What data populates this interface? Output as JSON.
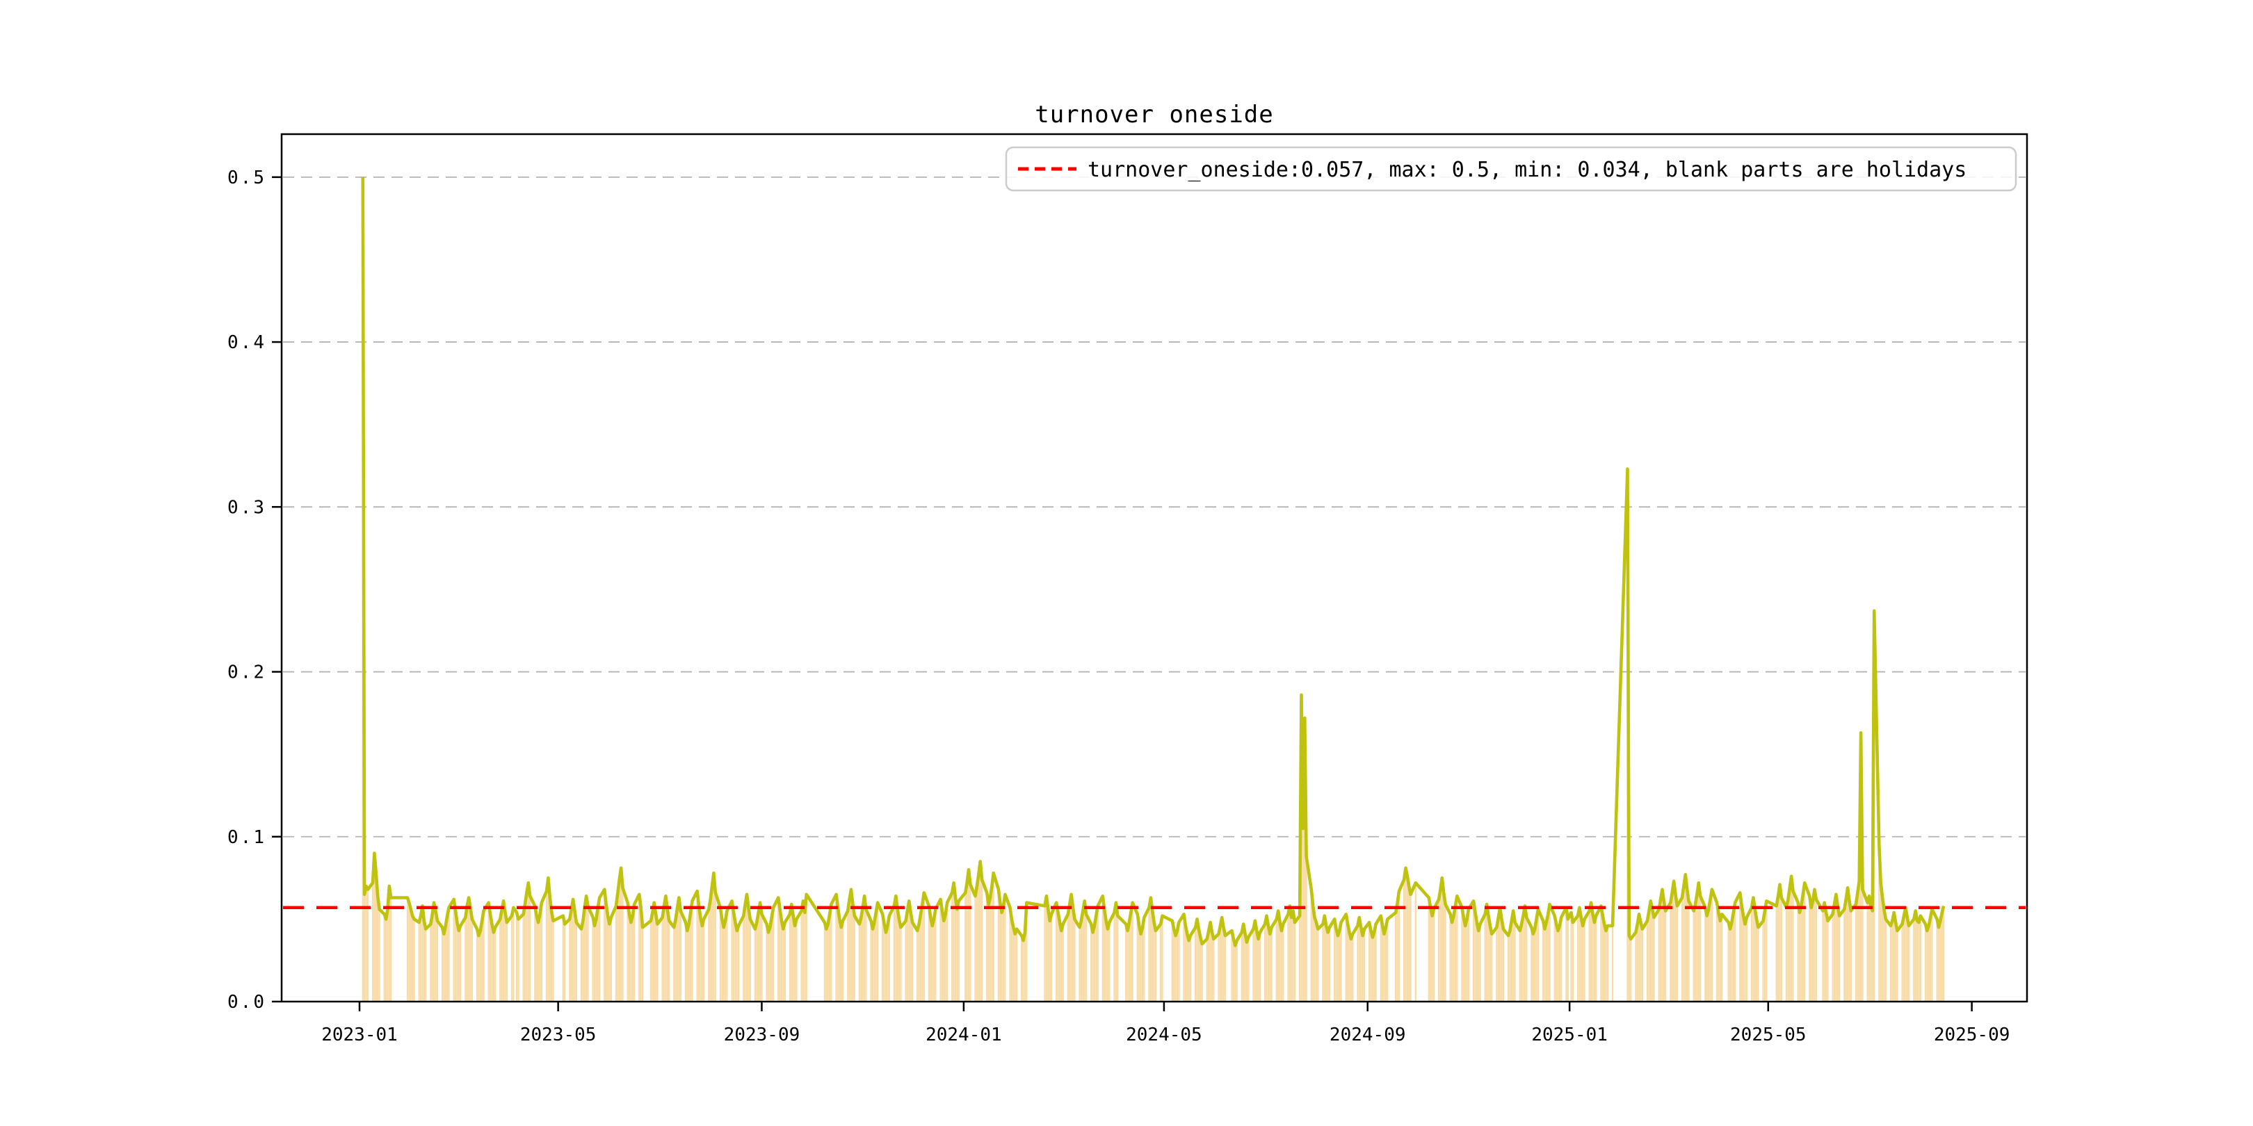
{
  "chart_data": {
    "type": "bar+line",
    "title": "turnover oneside",
    "legend": {
      "label": "turnover_oneside:0.057, max: 0.5, min: 0.034, blank parts are holidays",
      "symbol": "red-dashed-line",
      "position": "upper right"
    },
    "stats": {
      "mean": 0.057,
      "max": 0.5,
      "min": 0.034
    },
    "mean_line_value": 0.057,
    "note": "bars drawn per trading day; blank parts are weekends/holidays; line connects across gaps",
    "grid": "horizontal dashed",
    "ylim": [
      0.0,
      0.526
    ],
    "xlim": [
      "2022-11-15",
      "2025-10-03"
    ],
    "y_axis": {
      "ticks": [
        {
          "label": "0.0",
          "value": 0.0
        },
        {
          "label": "0.1",
          "value": 0.1
        },
        {
          "label": "0.2",
          "value": 0.2
        },
        {
          "label": "0.3",
          "value": 0.3
        },
        {
          "label": "0.4",
          "value": 0.4
        },
        {
          "label": "0.5",
          "value": 0.5
        }
      ]
    },
    "x_axis": {
      "ticks": [
        {
          "label": "2023-01",
          "date": "2023-01-01"
        },
        {
          "label": "2023-05",
          "date": "2023-05-01"
        },
        {
          "label": "2023-09",
          "date": "2023-09-01"
        },
        {
          "label": "2024-01",
          "date": "2024-01-01"
        },
        {
          "label": "2024-05",
          "date": "2024-05-01"
        },
        {
          "label": "2024-09",
          "date": "2024-09-01"
        },
        {
          "label": "2025-01",
          "date": "2025-01-01"
        },
        {
          "label": "2025-05",
          "date": "2025-05-01"
        },
        {
          "label": "2025-09",
          "date": "2025-09-01"
        }
      ]
    },
    "colors": {
      "line": "#bfc20e",
      "bar": "#f8dca8",
      "mean_line": "#ff0000",
      "grid": "#b3b3b3",
      "spine": "#000000",
      "legend_border": "#cccccc"
    },
    "runs": [
      {
        "start": "2023-01-03",
        "values": [
          0.5,
          0.065,
          0.07,
          0.068,
          0.072,
          0.09,
          0.078,
          0.064,
          0.056,
          0.053,
          0.05,
          0.056,
          0.07,
          0.063
        ]
      },
      {
        "start": "2023-01-30",
        "values": [
          0.063,
          0.06,
          0.056,
          0.052,
          0.05,
          0.048,
          0.052,
          0.058,
          0.049,
          0.044,
          0.047,
          0.053,
          0.06,
          0.055,
          0.049,
          0.045,
          0.041,
          0.046,
          0.052,
          0.057,
          0.062,
          0.055,
          0.048,
          0.043,
          0.046,
          0.051,
          0.058,
          0.063,
          0.057,
          0.05,
          0.044,
          0.04,
          0.043,
          0.049,
          0.055,
          0.06,
          0.053,
          0.047,
          0.042,
          0.045,
          0.05,
          0.056,
          0.061,
          0.054,
          0.048,
          0.052,
          0.057
        ]
      },
      {
        "start": "2023-04-06",
        "values": [
          0.054,
          0.05,
          0.053,
          0.059,
          0.066,
          0.072,
          0.064,
          0.058,
          0.052,
          0.048,
          0.053,
          0.06,
          0.067,
          0.075,
          0.063,
          0.055,
          0.049
        ]
      },
      {
        "start": "2023-05-04",
        "values": [
          0.052,
          0.047,
          0.05,
          0.056,
          0.062,
          0.055,
          0.048,
          0.044,
          0.049,
          0.057,
          0.064,
          0.058,
          0.051,
          0.046,
          0.05,
          0.057,
          0.063,
          0.068,
          0.059,
          0.052,
          0.047,
          0.051,
          0.058,
          0.066,
          0.074,
          0.081,
          0.069,
          0.06,
          0.053,
          0.048,
          0.052,
          0.059,
          0.065,
          0.057,
          0.045
        ]
      },
      {
        "start": "2023-06-26",
        "values": [
          0.049,
          0.054,
          0.06,
          0.053,
          0.047,
          0.051,
          0.058,
          0.064,
          0.056,
          0.049,
          0.045,
          0.05,
          0.057,
          0.063,
          0.055,
          0.048,
          0.043,
          0.047,
          0.054,
          0.061,
          0.067,
          0.058,
          0.051,
          0.046,
          0.05,
          0.056,
          0.062,
          0.07,
          0.078,
          0.066,
          0.057,
          0.05,
          0.045,
          0.049,
          0.055,
          0.061,
          0.054,
          0.048,
          0.043,
          0.046,
          0.052,
          0.059,
          0.065,
          0.057,
          0.05,
          0.044,
          0.048,
          0.054,
          0.06,
          0.053,
          0.047,
          0.042,
          0.045,
          0.051,
          0.057,
          0.063,
          0.056,
          0.049,
          0.044,
          0.048,
          0.053,
          0.059,
          0.052,
          0.046,
          0.05,
          0.055,
          0.061,
          0.054,
          0.065
        ]
      },
      {
        "start": "2023-10-09",
        "values": [
          0.048,
          0.044,
          0.047,
          0.053,
          0.059,
          0.065,
          0.057,
          0.05,
          0.045,
          0.049,
          0.055,
          0.062,
          0.068,
          0.059,
          0.052,
          0.047,
          0.051,
          0.057,
          0.064,
          0.056,
          0.049,
          0.044,
          0.048,
          0.054,
          0.06,
          0.053,
          0.047,
          0.042,
          0.046,
          0.052,
          0.058,
          0.064,
          0.056,
          0.05,
          0.045,
          0.049,
          0.055,
          0.061,
          0.054,
          0.048,
          0.043,
          0.047,
          0.053,
          0.059,
          0.066,
          0.058,
          0.051,
          0.046,
          0.05,
          0.056,
          0.062,
          0.055,
          0.049,
          0.053,
          0.06,
          0.066,
          0.072,
          0.063,
          0.056,
          0.061
        ]
      },
      {
        "start": "2024-01-02",
        "values": [
          0.066,
          0.072,
          0.08,
          0.071,
          0.064,
          0.07,
          0.077,
          0.085,
          0.074,
          0.066,
          0.059,
          0.063,
          0.07,
          0.078,
          0.068,
          0.06,
          0.054,
          0.058,
          0.065,
          0.057,
          0.05,
          0.045,
          0.041,
          0.044,
          0.04,
          0.037,
          0.042,
          0.06
        ]
      },
      {
        "start": "2024-02-19",
        "values": [
          0.058,
          0.064,
          0.056,
          0.049,
          0.053,
          0.06,
          0.054,
          0.048,
          0.043,
          0.047,
          0.053,
          0.059,
          0.065,
          0.057,
          0.05,
          0.045,
          0.049,
          0.055,
          0.061,
          0.053,
          0.047,
          0.042,
          0.046,
          0.052,
          0.058,
          0.064,
          0.056,
          0.049,
          0.044,
          0.048,
          0.054,
          0.06,
          0.052
        ]
      },
      {
        "start": "2024-04-08",
        "values": [
          0.047,
          0.043,
          0.048,
          0.054,
          0.06,
          0.053,
          0.046,
          0.041,
          0.045,
          0.051,
          0.057,
          0.063,
          0.055,
          0.048,
          0.043,
          0.047,
          0.052
        ]
      },
      {
        "start": "2024-05-06",
        "values": [
          0.049,
          0.044,
          0.04,
          0.043,
          0.048,
          0.053,
          0.046,
          0.041,
          0.037,
          0.04,
          0.045,
          0.05,
          0.044,
          0.039,
          0.035,
          0.038,
          0.043,
          0.048,
          0.042,
          0.038,
          0.041,
          0.046,
          0.051,
          0.045,
          0.04
        ]
      },
      {
        "start": "2024-06-11",
        "values": [
          0.043,
          0.038,
          0.034,
          0.037,
          0.042,
          0.047,
          0.041,
          0.036,
          0.039,
          0.044,
          0.049,
          0.043,
          0.038,
          0.042,
          0.047,
          0.052,
          0.046,
          0.041,
          0.045,
          0.05,
          0.055,
          0.048,
          0.043,
          0.047,
          0.053,
          0.058,
          0.051,
          0.055,
          0.048,
          0.052,
          0.186,
          0.105,
          0.172,
          0.088,
          0.068,
          0.058,
          0.051,
          0.048,
          0.044,
          0.047,
          0.052,
          0.046,
          0.042,
          0.045,
          0.05,
          0.044,
          0.04,
          0.043,
          0.048,
          0.053,
          0.047,
          0.042,
          0.038,
          0.041,
          0.046,
          0.051,
          0.045,
          0.04,
          0.044,
          0.048,
          0.043,
          0.039,
          0.042,
          0.047,
          0.052,
          0.046,
          0.041,
          0.045,
          0.05
        ]
      },
      {
        "start": "2024-09-18",
        "values": [
          0.054,
          0.06,
          0.067,
          0.074,
          0.081,
          0.076,
          0.07,
          0.065,
          0.072
        ]
      },
      {
        "start": "2024-10-08",
        "values": [
          0.063,
          0.057,
          0.052,
          0.056,
          0.062,
          0.068,
          0.075,
          0.066,
          0.059,
          0.053,
          0.048,
          0.052,
          0.058,
          0.064,
          0.057,
          0.051,
          0.046,
          0.05,
          0.056,
          0.061,
          0.054,
          0.048,
          0.043,
          0.047,
          0.053,
          0.059,
          0.052,
          0.046,
          0.041,
          0.045,
          0.051,
          0.057,
          0.05,
          0.044,
          0.04,
          0.043,
          0.049,
          0.055,
          0.048,
          0.043,
          0.047,
          0.052,
          0.058,
          0.051,
          0.045,
          0.041,
          0.044,
          0.05,
          0.056,
          0.049,
          0.044,
          0.048,
          0.053,
          0.059,
          0.052,
          0.047,
          0.043,
          0.046,
          0.051,
          0.057,
          0.05
        ]
      },
      {
        "start": "2025-01-02",
        "values": [
          0.054,
          0.048,
          0.052,
          0.057,
          0.051,
          0.046,
          0.05,
          0.055,
          0.06,
          0.053,
          0.048,
          0.052,
          0.058,
          0.052,
          0.047,
          0.043,
          0.046,
          0.046
        ]
      },
      {
        "start": "2025-02-05",
        "values": [
          0.323,
          0.04,
          0.038,
          0.042,
          0.047,
          0.053,
          0.048,
          0.044,
          0.049,
          0.055,
          0.061,
          0.056,
          0.051,
          0.056,
          0.062,
          0.068,
          0.061,
          0.055,
          0.06,
          0.066,
          0.073,
          0.065,
          0.058,
          0.063,
          0.07,
          0.077,
          0.068,
          0.061,
          0.055,
          0.059,
          0.065,
          0.072,
          0.064,
          0.057,
          0.052,
          0.056,
          0.062,
          0.068,
          0.06,
          0.054,
          0.049,
          0.053
        ]
      },
      {
        "start": "2025-04-07",
        "values": [
          0.048,
          0.044,
          0.048,
          0.054,
          0.06,
          0.066,
          0.058,
          0.052,
          0.047,
          0.051,
          0.057,
          0.063,
          0.056,
          0.05,
          0.045,
          0.049,
          0.055,
          0.061
        ]
      },
      {
        "start": "2025-05-06",
        "values": [
          0.058,
          0.064,
          0.071,
          0.063,
          0.057,
          0.062,
          0.069,
          0.076,
          0.067,
          0.06,
          0.054,
          0.058,
          0.065,
          0.072,
          0.064,
          0.057,
          0.061,
          0.068,
          0.062
        ]
      },
      {
        "start": "2025-06-03",
        "values": [
          0.055,
          0.06,
          0.054,
          0.049,
          0.053,
          0.059,
          0.065,
          0.058,
          0.052,
          0.056,
          0.062,
          0.069,
          0.061,
          0.055,
          0.059,
          0.066,
          0.073,
          0.163,
          0.068,
          0.06,
          0.064,
          0.058,
          0.055,
          0.237,
          0.095,
          0.072,
          0.063,
          0.056,
          0.05,
          0.046,
          0.049,
          0.054,
          0.048,
          0.043,
          0.047,
          0.052,
          0.057,
          0.051,
          0.046,
          0.05,
          0.055,
          0.049,
          0.048,
          0.052,
          0.047,
          0.043,
          0.046,
          0.051,
          0.056,
          0.05,
          0.045,
          0.049,
          0.054,
          0.058
        ]
      }
    ]
  }
}
